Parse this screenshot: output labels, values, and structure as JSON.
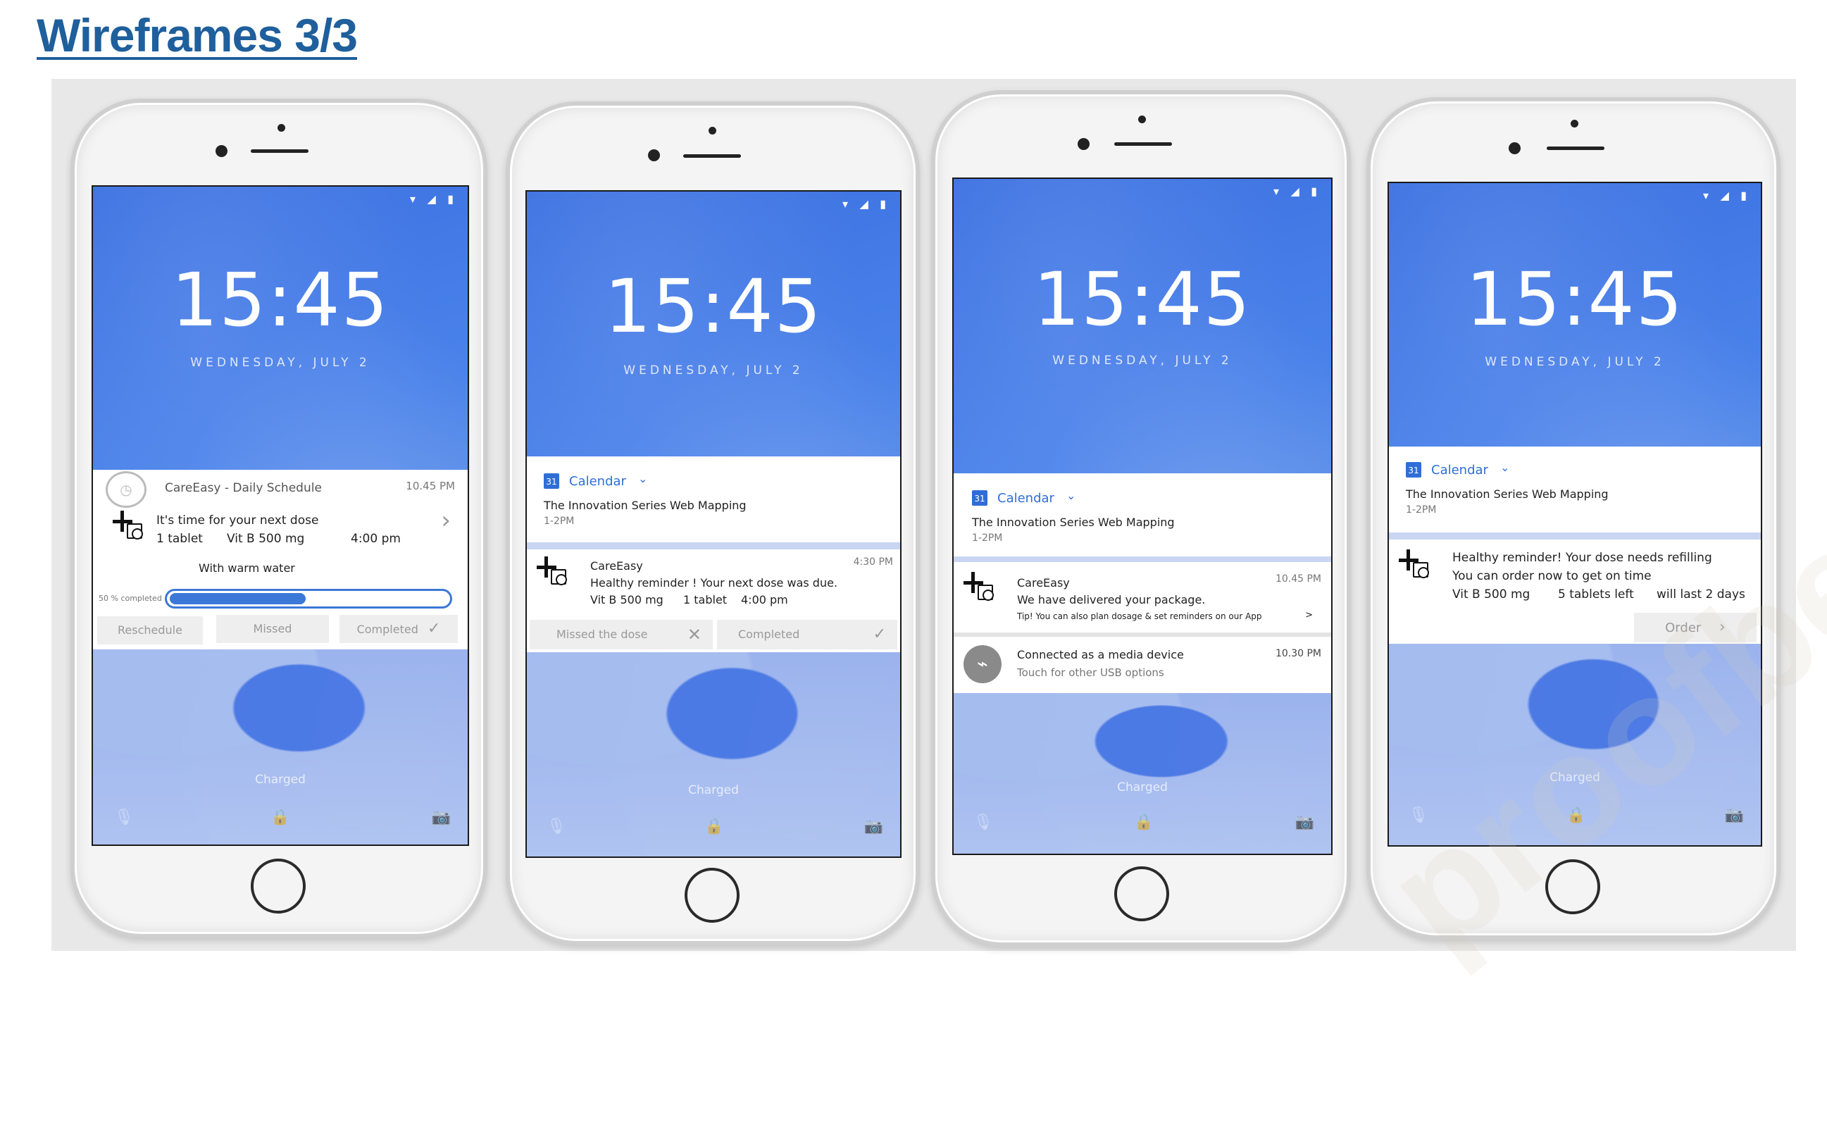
{
  "title": "Wireframes 3/3",
  "watermark": "proofbee",
  "lockscreen": {
    "time": "15:45",
    "date": "WEDNESDAY, JULY 2",
    "charged": "Charged",
    "status_icons": "▾ ◢ ▮",
    "mic_icon": "🎙",
    "lock_icon": "🔒",
    "camera_icon": "📷"
  },
  "phone1": {
    "app_name": "CareEasy - Daily Schedule",
    "time": "10.45 PM",
    "message": "It's time for your next dose",
    "qty": "1 tablet",
    "drug": "Vit B 500 mg",
    "dose_time": "4:00 pm",
    "instruction": "With warm water",
    "progress_label": "50 % completed",
    "progress_value": 0.5,
    "buttons": {
      "reschedule": "Reschedule",
      "missed": "Missed",
      "completed": "Completed"
    }
  },
  "phone2": {
    "cal_app": "Calendar",
    "cal_event": "The Innovation Series Web Mapping",
    "cal_time": "1-2PM",
    "app_name": "CareEasy",
    "time": "4:30 PM",
    "message": "Healthy reminder ! Your next dose was due.",
    "drug": "Vit B 500 mg",
    "qty": "1 tablet",
    "dose_time": "4:00 pm",
    "buttons": {
      "missed": "Missed the dose",
      "completed": "Completed"
    }
  },
  "phone3": {
    "cal_app": "Calendar",
    "cal_event": "The Innovation Series Web Mapping",
    "cal_time": "1-2PM",
    "app_name": "CareEasy",
    "time": "10.45 PM",
    "message": "We have delivered your package.",
    "tip": "Tip! You can also plan dosage & set reminders on our App",
    "tip_arrow": ">",
    "usb_title": "Connected as a media device",
    "usb_sub": "Touch for other USB options",
    "usb_time": "10.30 PM"
  },
  "phone4": {
    "cal_app": "Calendar",
    "cal_event": "The Innovation Series Web Mapping",
    "cal_time": "1-2PM",
    "line1": "Healthy reminder! Your dose needs refilling",
    "line2": "You can order now to get on time",
    "drug": "Vit B 500 mg",
    "left": "5 tablets left",
    "last": "will last 2 days",
    "order": "Order"
  }
}
